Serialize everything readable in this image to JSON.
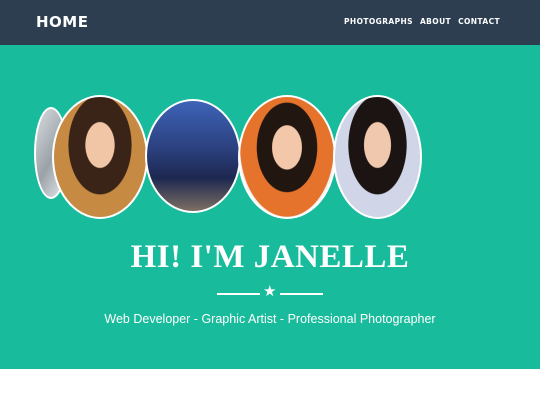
{
  "navbar": {
    "brand": "HOME",
    "links": [
      "PHOTOGRAPHS",
      "ABOUT",
      "CONTACT"
    ]
  },
  "hero": {
    "title": "HI! I'M JANELLE",
    "subtitle": "Web Developer - Graphic Artist - Professional Photographer",
    "divider_icon": "star-icon",
    "photos": [
      "portrait-photo",
      "seaside-photo",
      "portrait-photo",
      "portrait-photo",
      "portrait-photo"
    ]
  },
  "colors": {
    "navbar_bg": "#2c3e50",
    "hero_bg": "#18bc9c",
    "text": "#ffffff",
    "page_bg": "#ffffff"
  }
}
